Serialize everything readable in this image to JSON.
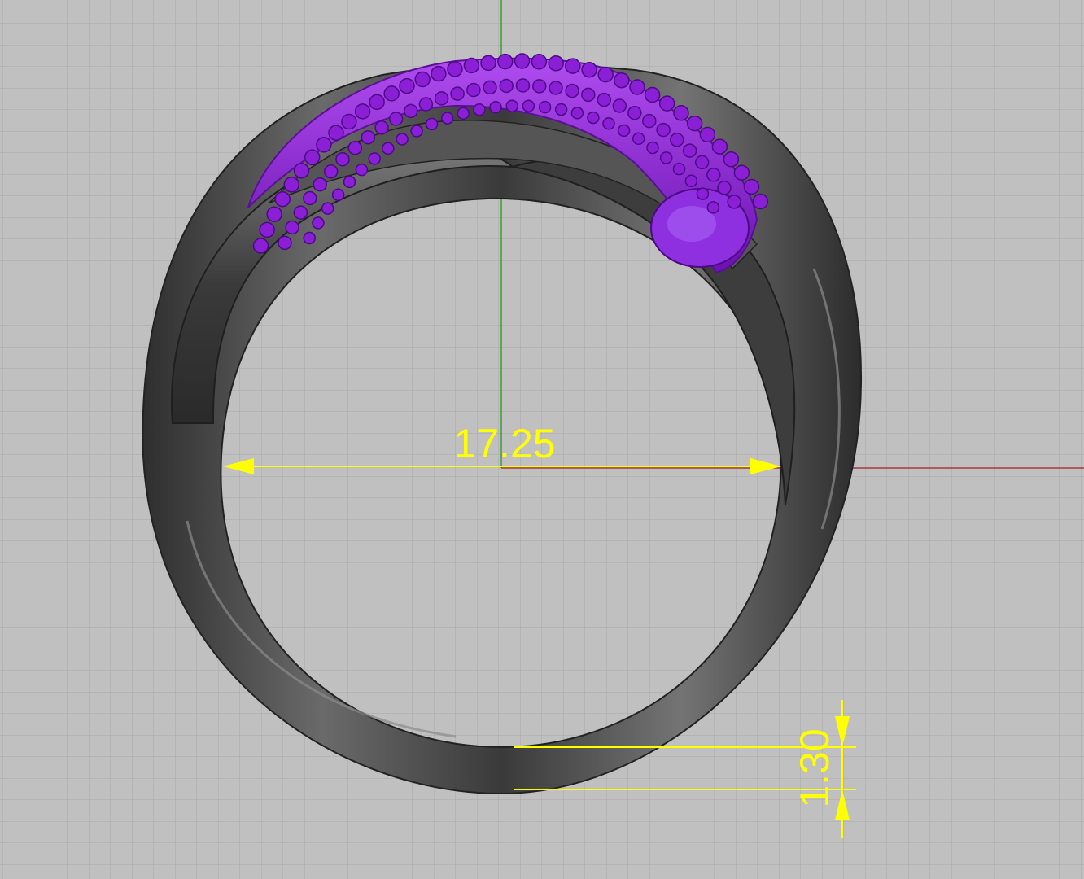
{
  "viewport": {
    "colors": {
      "background": "#c0c0c0",
      "grid": "#a9a9a9",
      "x_axis": "#a23a3a",
      "y_axis": "#3c9a3c",
      "metal": "#4a4a4a",
      "gems": "#8a1fd6",
      "dimension": "#ffff00"
    },
    "dimensions": {
      "width_value": "17.25",
      "thickness_value": "1.30"
    }
  }
}
